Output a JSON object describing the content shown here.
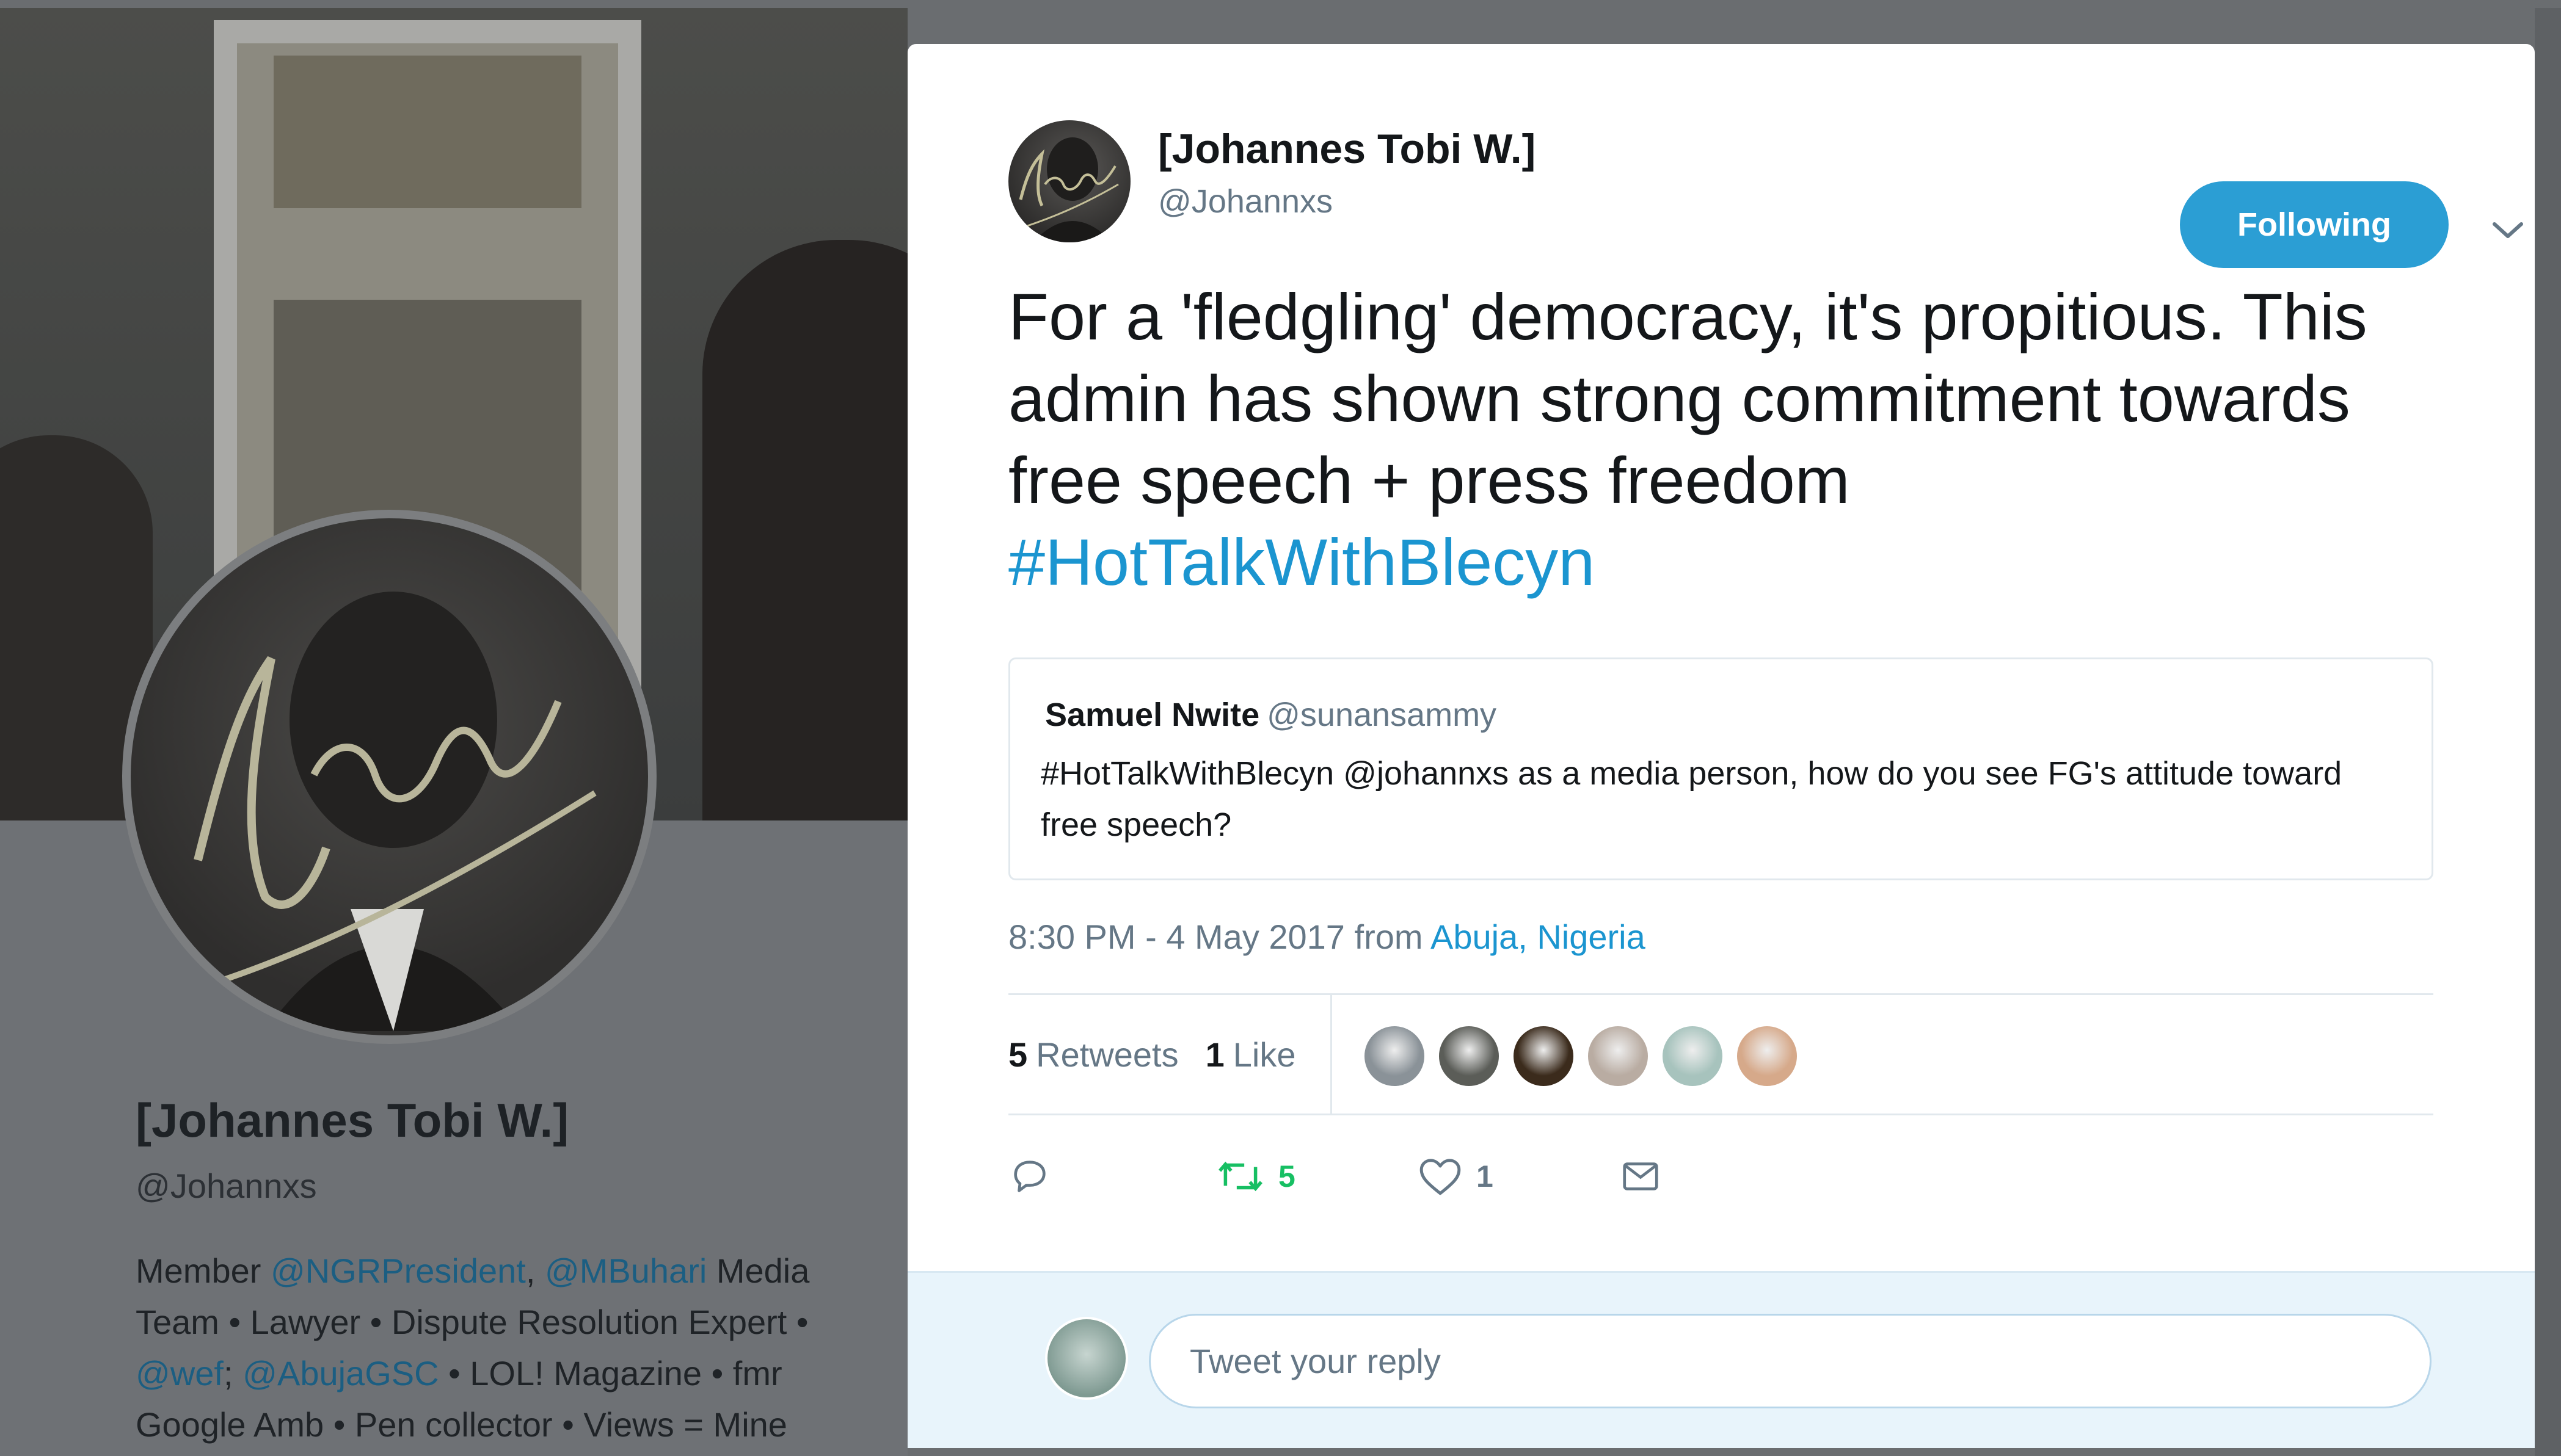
{
  "background_profile": {
    "name": "[Johannes Tobi W.]",
    "handle": "@Johannxs",
    "bio": [
      {
        "text": "Member ",
        "link": false
      },
      {
        "text": "@NGRPresident",
        "link": true
      },
      {
        "text": ", ",
        "link": false
      },
      {
        "text": "@MBuhari",
        "link": true
      },
      {
        "text": " Media Team • Lawyer • Dispute Resolution Expert • ",
        "link": false
      },
      {
        "text": "@wef",
        "link": true
      },
      {
        "text": "; ",
        "link": false
      },
      {
        "text": "@AbujaGSC",
        "link": true
      },
      {
        "text": " • LOL! Magazine • fmr Google Amb • Pen collector • Views = Mine",
        "link": false
      }
    ]
  },
  "tweet": {
    "author_name": "[Johannes Tobi W.]",
    "author_handle": "@Johannxs",
    "follow_label": "Following",
    "text": "For a 'fledgling' democracy, it's propitious. This admin has shown strong commitment towards free speech + press freedom ",
    "hashtag": "#HotTalkWithBlecyn",
    "quoted": {
      "name": "Samuel Nwite",
      "handle": "@sunansammy",
      "text": "#HotTalkWithBlecyn @johannxs as a media person, how do you see FG's attitude toward free speech?"
    },
    "meta": {
      "time_prefix": "8:30 PM - 4 May 2017 from ",
      "place": "Abuja, Nigeria"
    },
    "stats": {
      "retweets_count": "5",
      "retweets_label": "Retweets",
      "likes_count": "1",
      "likes_label": "Like"
    },
    "retweeter_avatars": [
      {
        "name": "retweeter-1",
        "color": "#8a9298"
      },
      {
        "name": "retweeter-2",
        "color": "#5b5d58"
      },
      {
        "name": "retweeter-3",
        "color": "#3b2b1c"
      },
      {
        "name": "retweeter-4",
        "color": "#b9aca2"
      },
      {
        "name": "retweeter-5",
        "color": "#a7c3bd"
      },
      {
        "name": "retweeter-6",
        "color": "#d6a98a"
      }
    ],
    "actions": {
      "retweet_count": "5",
      "like_count": "1"
    }
  },
  "reply": {
    "placeholder": "Tweet your reply"
  },
  "colors": {
    "accent": "#1b95d0",
    "follow_button": "#2b9ed4",
    "retweet_green": "#17bf63",
    "muted": "#657786"
  }
}
